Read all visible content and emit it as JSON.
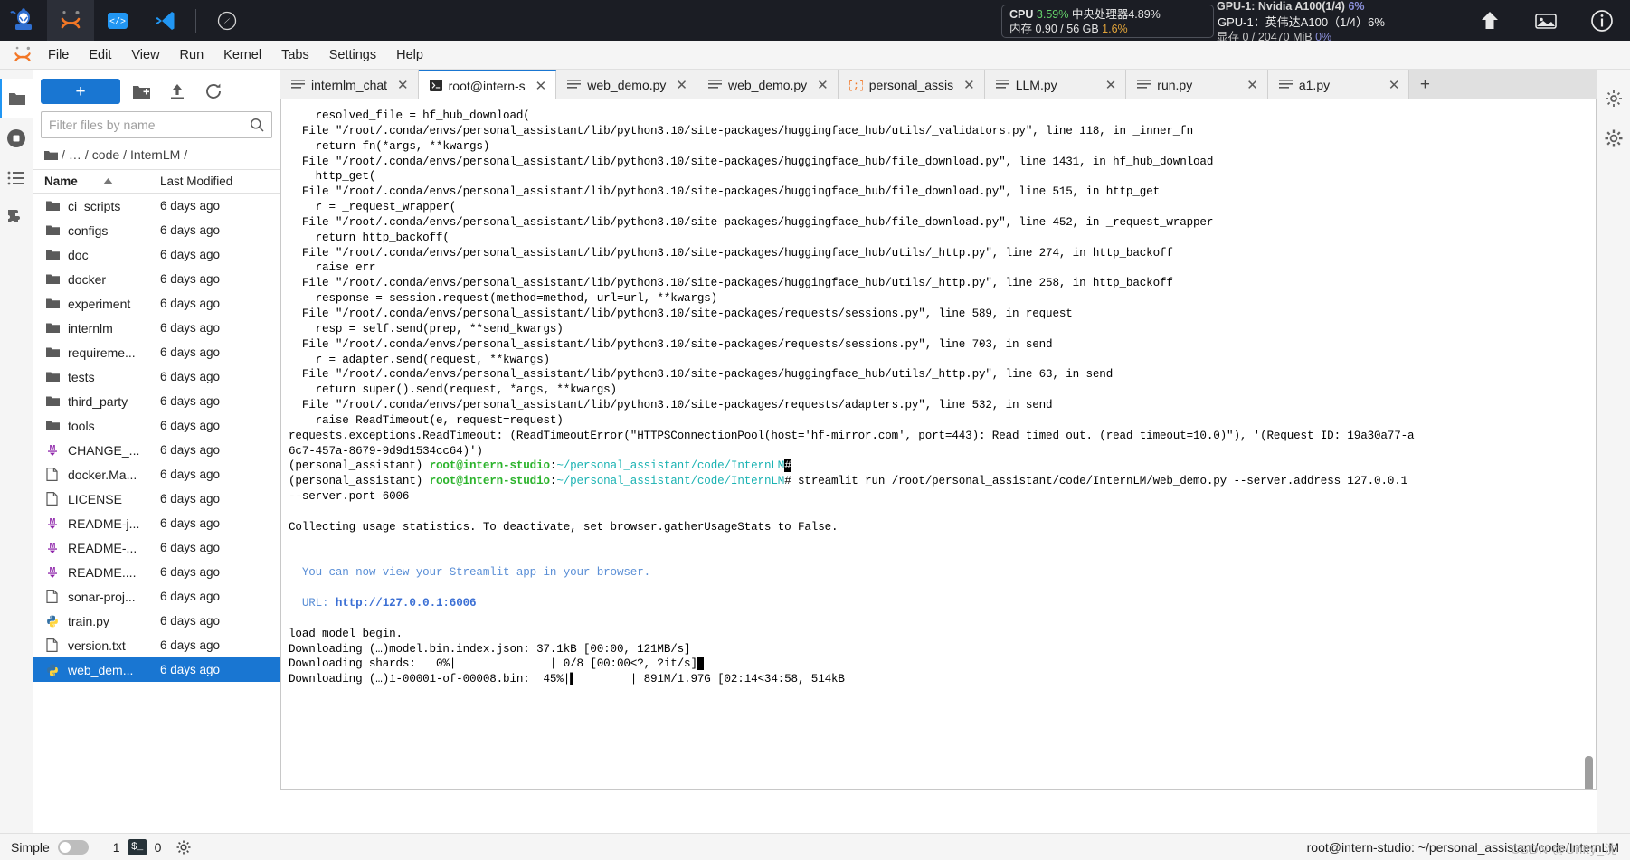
{
  "os_bar": {
    "launchers": [
      {
        "name": "ssh-robot-logo-icon"
      },
      {
        "name": "jupyter-logo-icon"
      },
      {
        "name": "code-server-icon"
      },
      {
        "name": "vscode-icon"
      },
      {
        "name": "compass-icon"
      }
    ],
    "stats": {
      "cpu_label": "CPU",
      "cpu_value": "3.59%",
      "cpu_cn_label": "中央处理器",
      "cpu_cn_value": "4.89%",
      "mem_label": "内存",
      "mem_value": "0.90 / 56 GB",
      "mem_pct": "1.6%",
      "gpu_overlay": "GPU-1：英伟达A100（1/4）6%",
      "gpu_ghost_top": "GPU-1: Nvidia A100(1/4)",
      "gpu_ghost_top_pct": "6%",
      "gpu_ghost_bottom": "显存 0 / 20470 MiB",
      "gpu_ghost_bottom_pct": "0%"
    },
    "right_icons": [
      {
        "name": "upload-arrow-icon"
      },
      {
        "name": "image-icon"
      },
      {
        "name": "info-icon"
      }
    ]
  },
  "menubar": {
    "logo": "jupyter-logo-icon",
    "items": [
      "File",
      "Edit",
      "View",
      "Run",
      "Kernel",
      "Tabs",
      "Settings",
      "Help"
    ]
  },
  "rail_left": [
    {
      "name": "sidebar-item-file-browser",
      "icon": "folder-icon",
      "selected": true
    },
    {
      "name": "sidebar-item-running",
      "icon": "stop-circle-icon",
      "selected": false
    },
    {
      "name": "sidebar-item-toc",
      "icon": "list-icon",
      "selected": false
    },
    {
      "name": "sidebar-item-extensions",
      "icon": "puzzle-icon",
      "selected": false
    }
  ],
  "rail_right": [
    {
      "name": "sidebar-item-property-inspector",
      "icon": "gear-icon"
    },
    {
      "name": "sidebar-item-settings",
      "icon": "sliders-icon"
    }
  ],
  "file_browser": {
    "new_button": "+",
    "toolbar_icons": [
      {
        "name": "new-folder-icon"
      },
      {
        "name": "upload-icon"
      },
      {
        "name": "refresh-icon"
      }
    ],
    "filter_placeholder": "Filter files by name",
    "filter_value": "",
    "breadcrumb": [
      "/",
      "…",
      "/",
      "code",
      "/",
      "InternLM",
      "/"
    ],
    "columns": {
      "name": "Name",
      "modified": "Last Modified"
    },
    "sort_dir": "asc",
    "files": [
      {
        "name": "ci_scripts",
        "type": "folder",
        "modified": "6 days ago",
        "selected": false
      },
      {
        "name": "configs",
        "type": "folder",
        "modified": "6 days ago",
        "selected": false
      },
      {
        "name": "doc",
        "type": "folder",
        "modified": "6 days ago",
        "selected": false
      },
      {
        "name": "docker",
        "type": "folder",
        "modified": "6 days ago",
        "selected": false
      },
      {
        "name": "experiment",
        "type": "folder",
        "modified": "6 days ago",
        "selected": false
      },
      {
        "name": "internlm",
        "type": "folder",
        "modified": "6 days ago",
        "selected": false
      },
      {
        "name": "requireme...",
        "type": "folder",
        "modified": "6 days ago",
        "selected": false
      },
      {
        "name": "tests",
        "type": "folder",
        "modified": "6 days ago",
        "selected": false
      },
      {
        "name": "third_party",
        "type": "folder",
        "modified": "6 days ago",
        "selected": false
      },
      {
        "name": "tools",
        "type": "folder",
        "modified": "6 days ago",
        "selected": false
      },
      {
        "name": "CHANGE_...",
        "type": "markdown",
        "modified": "6 days ago",
        "selected": false
      },
      {
        "name": "docker.Ma...",
        "type": "file",
        "modified": "6 days ago",
        "selected": false
      },
      {
        "name": "LICENSE",
        "type": "file",
        "modified": "6 days ago",
        "selected": false
      },
      {
        "name": "README-j...",
        "type": "markdown",
        "modified": "6 days ago",
        "selected": false
      },
      {
        "name": "README-...",
        "type": "markdown",
        "modified": "6 days ago",
        "selected": false
      },
      {
        "name": "README....",
        "type": "markdown",
        "modified": "6 days ago",
        "selected": false
      },
      {
        "name": "sonar-proj...",
        "type": "file",
        "modified": "6 days ago",
        "selected": false
      },
      {
        "name": "train.py",
        "type": "python",
        "modified": "6 days ago",
        "selected": false
      },
      {
        "name": "version.txt",
        "type": "file",
        "modified": "6 days ago",
        "selected": false
      },
      {
        "name": "web_dem...",
        "type": "python",
        "modified": "6 days ago",
        "selected": true
      }
    ]
  },
  "tabs": [
    {
      "label": "internlm_chat",
      "icon": "text-file-icon",
      "active": false
    },
    {
      "label": "root@intern-s",
      "icon": "terminal-icon",
      "active": true
    },
    {
      "label": "web_demo.py",
      "icon": "text-file-icon",
      "active": false
    },
    {
      "label": "web_demo.py",
      "icon": "text-file-icon",
      "active": false
    },
    {
      "label": "personal_assis",
      "icon": "notebook-icon",
      "active": false
    },
    {
      "label": "LLM.py",
      "icon": "text-file-icon",
      "active": false
    },
    {
      "label": "run.py",
      "icon": "text-file-icon",
      "active": false
    },
    {
      "label": "a1.py",
      "icon": "text-file-icon",
      "active": false
    }
  ],
  "tab_add": "+",
  "terminal": {
    "lines": [
      [
        {
          "t": "    resolved_file = hf_hub_download("
        }
      ],
      [
        {
          "t": "  File \"/root/.conda/envs/personal_assistant/lib/python3.10/site-packages/huggingface_hub/utils/_validators.py\", line 118, in _inner_fn"
        }
      ],
      [
        {
          "t": "    return fn(*args, **kwargs)"
        }
      ],
      [
        {
          "t": "  File \"/root/.conda/envs/personal_assistant/lib/python3.10/site-packages/huggingface_hub/file_download.py\", line 1431, in hf_hub_download"
        }
      ],
      [
        {
          "t": "    http_get("
        }
      ],
      [
        {
          "t": "  File \"/root/.conda/envs/personal_assistant/lib/python3.10/site-packages/huggingface_hub/file_download.py\", line 515, in http_get"
        }
      ],
      [
        {
          "t": "    r = _request_wrapper("
        }
      ],
      [
        {
          "t": "  File \"/root/.conda/envs/personal_assistant/lib/python3.10/site-packages/huggingface_hub/file_download.py\", line 452, in _request_wrapper"
        }
      ],
      [
        {
          "t": "    return http_backoff("
        }
      ],
      [
        {
          "t": "  File \"/root/.conda/envs/personal_assistant/lib/python3.10/site-packages/huggingface_hub/utils/_http.py\", line 274, in http_backoff"
        }
      ],
      [
        {
          "t": "    raise err"
        }
      ],
      [
        {
          "t": "  File \"/root/.conda/envs/personal_assistant/lib/python3.10/site-packages/huggingface_hub/utils/_http.py\", line 258, in http_backoff"
        }
      ],
      [
        {
          "t": "    response = session.request(method=method, url=url, **kwargs)"
        }
      ],
      [
        {
          "t": "  File \"/root/.conda/envs/personal_assistant/lib/python3.10/site-packages/requests/sessions.py\", line 589, in request"
        }
      ],
      [
        {
          "t": "    resp = self.send(prep, **send_kwargs)"
        }
      ],
      [
        {
          "t": "  File \"/root/.conda/envs/personal_assistant/lib/python3.10/site-packages/requests/sessions.py\", line 703, in send"
        }
      ],
      [
        {
          "t": "    r = adapter.send(request, **kwargs)"
        }
      ],
      [
        {
          "t": "  File \"/root/.conda/envs/personal_assistant/lib/python3.10/site-packages/huggingface_hub/utils/_http.py\", line 63, in send"
        }
      ],
      [
        {
          "t": "    return super().send(request, *args, **kwargs)"
        }
      ],
      [
        {
          "t": "  File \"/root/.conda/envs/personal_assistant/lib/python3.10/site-packages/requests/adapters.py\", line 532, in send"
        }
      ],
      [
        {
          "t": "    raise ReadTimeout(e, request=request)"
        }
      ],
      [
        {
          "t": "requests.exceptions.ReadTimeout: (ReadTimeoutError(\"HTTPSConnectionPool(host='hf-mirror.com', port=443): Read timed out. (read timeout=10.0)\"), '(Request ID: 19a30a77-a"
        }
      ],
      [
        {
          "t": "6c7-457a-8679-9d9d1534cc64)')"
        }
      ],
      [
        {
          "t": "(personal_assistant) "
        },
        {
          "t": "root@intern-studio",
          "c": "gr"
        },
        {
          "t": ":"
        },
        {
          "t": "~/personal_assistant/code/InternLM",
          "c": "cy"
        },
        {
          "t": "#",
          "c": "cur"
        }
      ],
      [
        {
          "t": "(personal_assistant) "
        },
        {
          "t": "root@intern-studio",
          "c": "gr"
        },
        {
          "t": ":"
        },
        {
          "t": "~/personal_assistant/code/InternLM",
          "c": "cy"
        },
        {
          "t": "# streamlit run /root/personal_assistant/code/InternLM/web_demo.py --server.address 127.0.0.1"
        }
      ],
      [
        {
          "t": "--server.port 6006"
        }
      ],
      [
        {
          "t": ""
        }
      ],
      [
        {
          "t": "Collecting usage statistics. To deactivate, set browser.gatherUsageStats to False."
        }
      ],
      [
        {
          "t": ""
        }
      ],
      [
        {
          "t": ""
        }
      ],
      [
        {
          "t": "  You can now view your Streamlit app in your browser.",
          "c": "sbl"
        }
      ],
      [
        {
          "t": ""
        }
      ],
      [
        {
          "t": "  URL: ",
          "c": "sbl"
        },
        {
          "t": "http://127.0.0.1:6006",
          "c": "bl"
        }
      ],
      [
        {
          "t": ""
        }
      ],
      [
        {
          "t": "load model begin."
        }
      ],
      [
        {
          "t": "Downloading (…)model.bin.index.json: 37.1kB [00:00, 121MB/s]"
        }
      ],
      [
        {
          "t": "Downloading shards:   0%|              | 0/8 [00:00<?, ?it/s]"
        },
        {
          "t": " ",
          "c": "cur"
        }
      ],
      [
        {
          "t": "Downloading (…)1-00001-of-00008.bin:  45%|▌        | 891M/1.97G [02:14<34:58, 514kB"
        }
      ]
    ],
    "scrollbar": "vertical-scrollbar"
  },
  "statusbar": {
    "simple_label": "Simple",
    "toggle_state": "off",
    "terminal_count": "1",
    "kernel_icon": "terminal-badge-icon",
    "kernel_count": "0",
    "gear_icon": "settings-gear-icon",
    "right_text": "root@intern-studio: ~/personal_assistant/code/InternLM",
    "watermark": "CSDN @Unity_沈"
  }
}
